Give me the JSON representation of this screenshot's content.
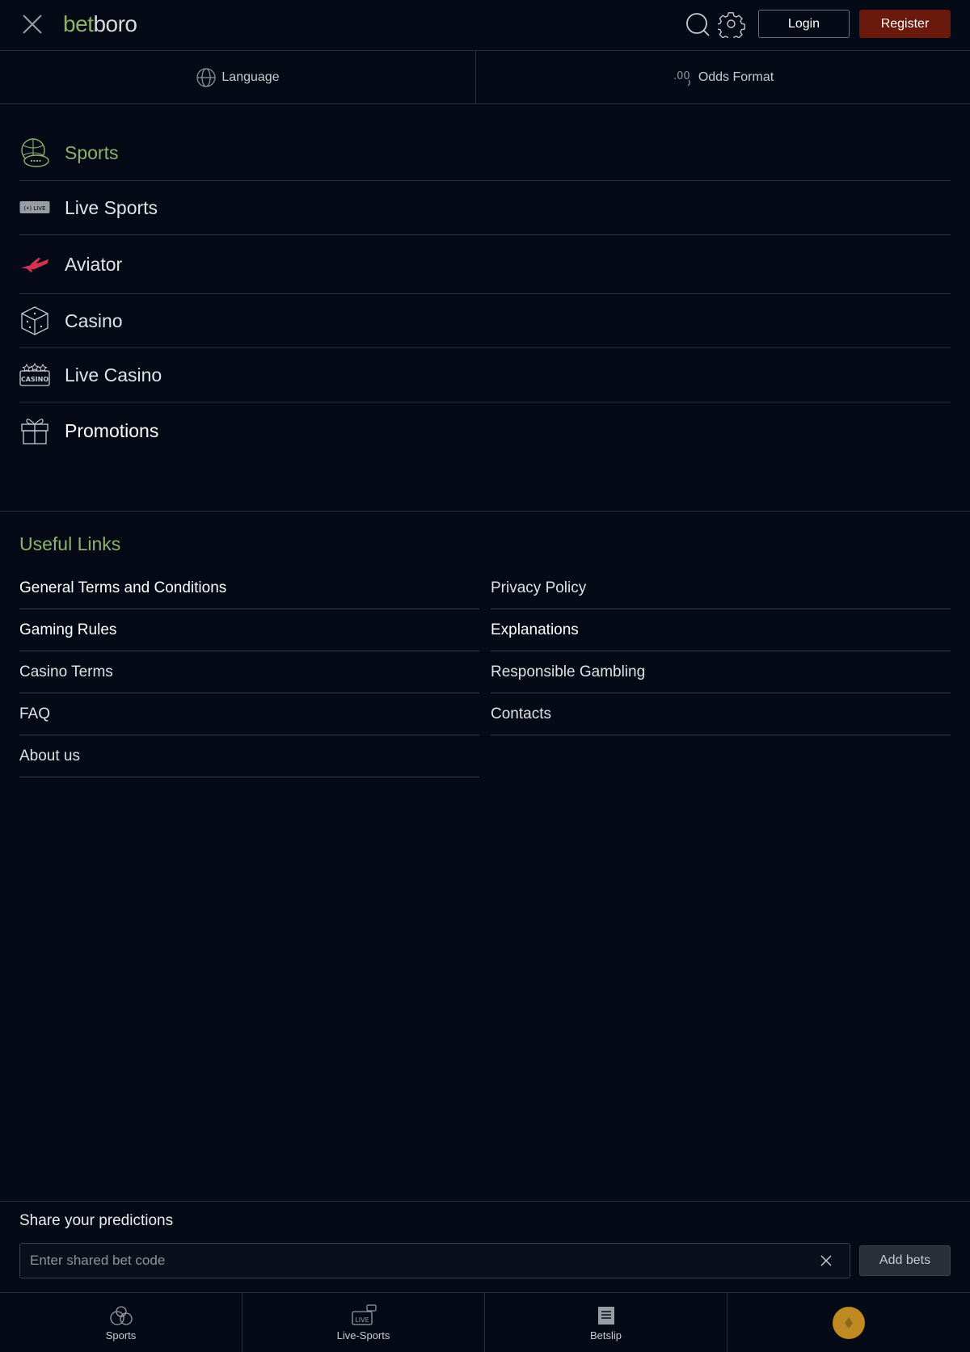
{
  "header": {
    "logo_part1": "bet",
    "logo_part2": "boro",
    "login_label": "Login",
    "register_label": "Register"
  },
  "settings": {
    "language_label": "Language",
    "odds_label": "Odds Format"
  },
  "menu": {
    "items": [
      {
        "label": "Sports",
        "icon": "sports-icon",
        "active": true
      },
      {
        "label": "Live Sports",
        "icon": "live-sports-icon"
      },
      {
        "label": "Aviator",
        "icon": "aviator-icon"
      },
      {
        "label": "Casino",
        "icon": "dice-icon"
      },
      {
        "label": "Live Casino",
        "icon": "live-casino-icon"
      },
      {
        "label": "Promotions",
        "icon": "gift-icon"
      }
    ]
  },
  "useful_links": {
    "title": "Useful Links",
    "left": [
      "General Terms and Conditions",
      "Gaming Rules",
      "Casino Terms",
      "FAQ",
      "About us"
    ],
    "right": [
      "Privacy Policy",
      "Explanations",
      "Responsible Gambling",
      "Contacts"
    ]
  },
  "share": {
    "title": "Share your predictions",
    "placeholder": "Enter shared bet code",
    "value": "",
    "add_label": "Add bets"
  },
  "bottom_nav": {
    "items": [
      {
        "label": "Sports",
        "icon": "sports-balls-icon"
      },
      {
        "label": "Live-Sports",
        "icon": "live-chat-icon"
      },
      {
        "label": "Betslip",
        "icon": "receipt-icon"
      },
      {
        "label": "",
        "icon": "coin-icon"
      }
    ]
  },
  "colors": {
    "background": "#050a16",
    "accent_green": "#8fb26a",
    "register_bg": "#6a1a0c",
    "coin": "#c08a22"
  }
}
